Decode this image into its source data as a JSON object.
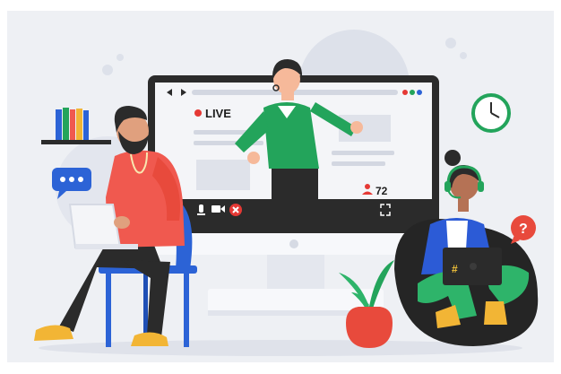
{
  "illustration": {
    "live_label": "LIVE",
    "viewer_count": "72",
    "question_mark": "?",
    "laptop_sticker": "#"
  },
  "colors": {
    "background_panel": "#eef0f4",
    "monitor_frame": "#2b2b2b",
    "screen": "#f4f5f8",
    "live_dot": "#e53935",
    "speaker_shirt": "#23a45b",
    "man_shirt": "#f0594f",
    "chair": "#2c63d6",
    "woman_hoodie": "#2c5bd6",
    "beanbag": "#252525",
    "plant_leaf": "#2eb46a",
    "plant_pot": "#e84a3c",
    "shoes": "#f2b535"
  },
  "icons": [
    "play-back-icon",
    "play-forward-icon",
    "mic-icon",
    "camera-icon",
    "end-call-icon",
    "fullscreen-icon",
    "viewer-icon",
    "chat-bubble-icon",
    "question-bubble-icon",
    "clock-icon",
    "headset-icon"
  ]
}
